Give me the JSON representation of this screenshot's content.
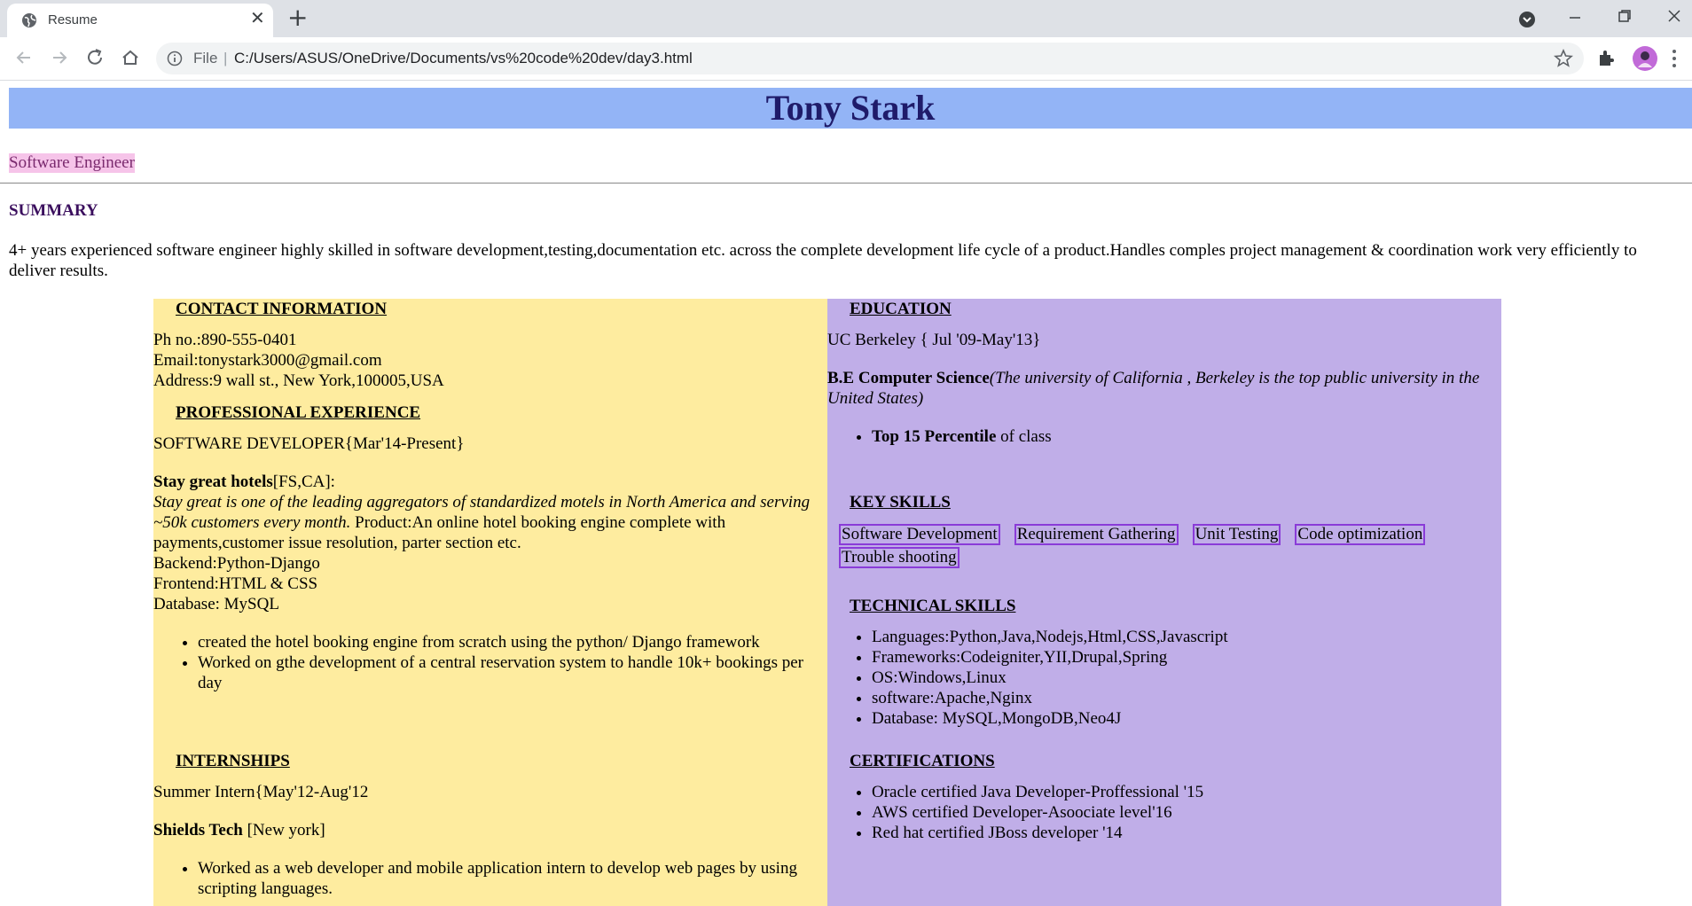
{
  "browser": {
    "tab_title": "Resume",
    "address_scheme": "File",
    "address_url": "C:/Users/ASUS/OneDrive/Documents/vs%20code%20dev/day3.html"
  },
  "resume": {
    "name": "Tony Stark",
    "role": "Software Engineer",
    "summary_title": "SUMMARY",
    "summary_text": "4+ years experienced software engineer highly skilled in software development,testing,documentation etc. across the complete development life cycle of a product.Handles comples project management & coordination work very efficiently to deliver results.",
    "contact": {
      "title": "CONTACT INFORMATION",
      "phone": "Ph no.:890-555-0401",
      "email": "Email:tonystark3000@gmail.com",
      "address": "Address:9 wall st., New York,100005,USA"
    },
    "experience": {
      "title": "PROFESSIONAL EXPERIENCE",
      "position": "SOFTWARE DEVELOPER{Mar'14-Present}",
      "company": "Stay great hotels",
      "company_loc": "[FS,CA]:",
      "description_italic": "Stay great is one of the leading aggregators of standardized motels in North America and serving ~50k customers every month.",
      "description_plain": " Product:An online hotel booking engine complete with payments,customer issue resolution, parter section etc.",
      "backend": "Backend:Python-Django",
      "frontend": "Frontend:HTML & CSS",
      "database": "Database: MySQL",
      "bullets": [
        "created the hotel booking engine from scratch using the python/ Django framework",
        "Worked on gthe development of a central reservation system to handle 10k+ bookings per day"
      ]
    },
    "internships": {
      "title": "INTERNSHIPS",
      "position": "Summer Intern{May'12-Aug'12",
      "company": "Shields Tech",
      "company_loc": " [New york]",
      "bullets": [
        "Worked as a web developer and mobile application intern to develop web pages by using scripting languages."
      ]
    },
    "education": {
      "title": "EDUCATION",
      "school": "UC Berkeley { Jul '09-May'13}",
      "degree": "B.E Computer Science",
      "degree_note": "(The university of California , Berkeley is the top public university in the United States)",
      "bullet_bold": "Top 15 Percentile",
      "bullet_rest": " of class"
    },
    "key_skills": {
      "title": "KEY SKILLS",
      "items": [
        "Software Development",
        "Requirement Gathering",
        "Unit Testing",
        "Code optimization",
        "Trouble shooting"
      ]
    },
    "technical_skills": {
      "title": "TECHNICAL SKILLS",
      "items": [
        "Languages:Python,Java,Nodejs,Html,CSS,Javascript",
        "Frameworks:Codeigniter,YII,Drupal,Spring",
        "OS:Windows,Linux",
        "software:Apache,Nginx",
        "Database: MySQL,MongoDB,Neo4J"
      ]
    },
    "certifications": {
      "title": "CERTIFICATIONS",
      "items": [
        "Oracle certified Java Developer-Proffessional '15",
        "AWS certified Developer-Asoociate level'16",
        "Red hat certified JBoss developer '14"
      ]
    }
  }
}
